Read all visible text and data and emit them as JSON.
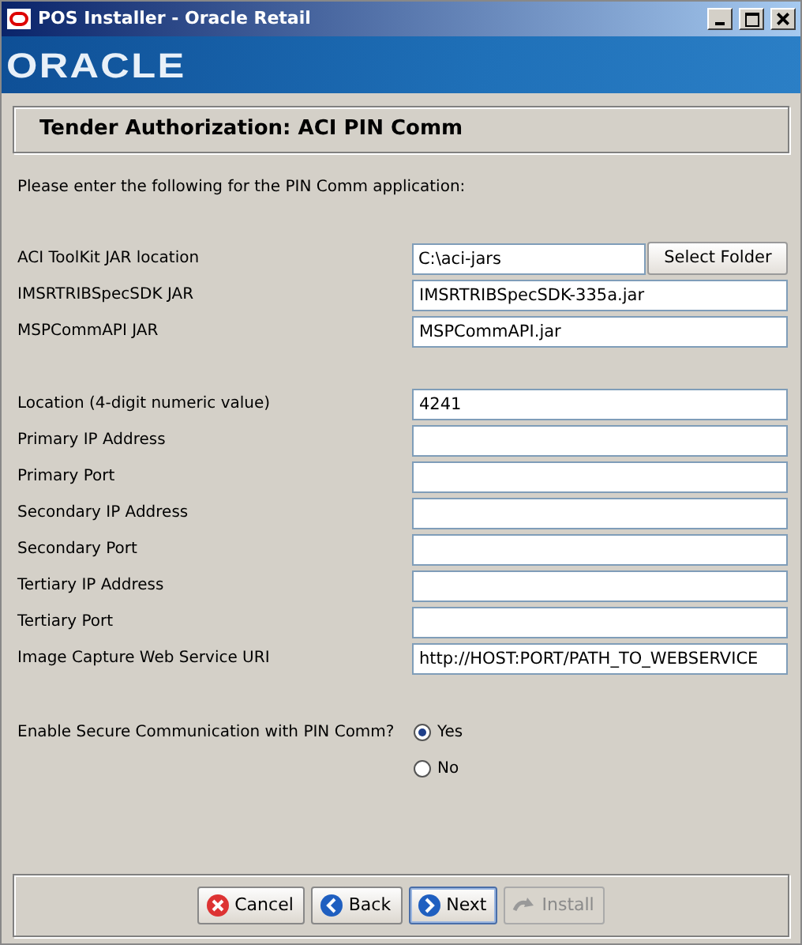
{
  "window": {
    "title": "POS Installer - Oracle Retail",
    "controls": [
      {
        "kind": "minimize"
      },
      {
        "kind": "maximize"
      },
      {
        "kind": "close"
      }
    ]
  },
  "banner": {
    "logo": "ORACLE"
  },
  "heading": "Tender Authorization: ACI PIN Comm",
  "intro": "Please enter the following for the PIN Comm application:",
  "field_groups": [
    [
      {
        "label": "ACI ToolKit JAR location",
        "value": "C:\\aci-jars",
        "button": "Select Folder"
      },
      {
        "label": "IMSRTRIBSpecSDK JAR",
        "value": "IMSRTRIBSpecSDK-335a.jar"
      },
      {
        "label": "MSPCommAPI JAR",
        "value": "MSPCommAPI.jar"
      }
    ],
    [
      {
        "label": "Location (4-digit numeric value)",
        "value": "4241"
      },
      {
        "label": "Primary IP Address"
      },
      {
        "label": "Primary Port"
      },
      {
        "label": "Secondary IP Address"
      },
      {
        "label": "Secondary Port"
      },
      {
        "label": "Tertiary IP Address"
      },
      {
        "label": "Tertiary Port"
      },
      {
        "label": "Image Capture Web Service URI",
        "value": "http://HOST:PORT/PATH_TO_WEBSERVICE"
      }
    ]
  ],
  "secure": {
    "question": "Enable Secure Communication with PIN Comm?",
    "options": [
      {
        "label": "Yes",
        "selected": true
      },
      {
        "label": "No",
        "selected": false
      }
    ]
  },
  "buttons": [
    {
      "label": "Cancel",
      "kind": "cancel",
      "disabled": false,
      "default": false
    },
    {
      "label": "Back",
      "kind": "back",
      "disabled": false,
      "default": false
    },
    {
      "label": "Next",
      "kind": "next",
      "disabled": false,
      "default": true
    },
    {
      "label": "Install",
      "kind": "install",
      "disabled": true,
      "default": false
    }
  ]
}
